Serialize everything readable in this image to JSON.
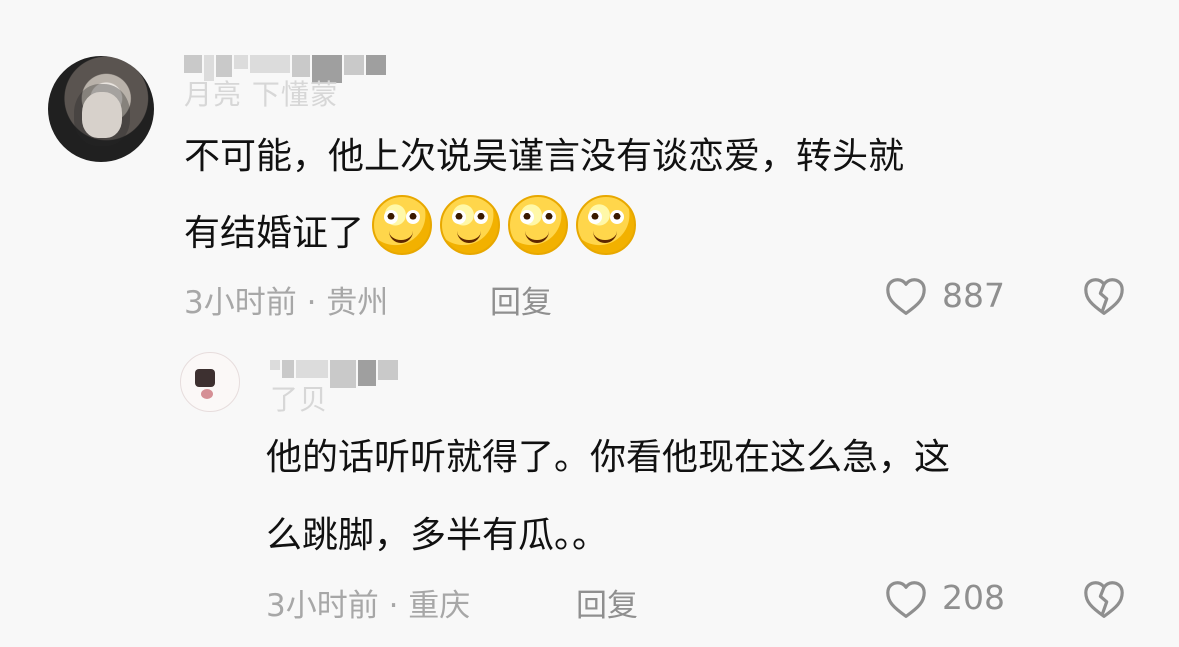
{
  "comments": [
    {
      "username": "月亮  下懂蒙",
      "text_line1": "不可能，他上次说吴谨言没有谈恋爱，转头就",
      "text_line2": "有结婚证了",
      "meta": "3小时前 · 贵州",
      "reply_label": "回复",
      "likes": "887"
    },
    {
      "username": "了贝",
      "text_line1": "他的话听听就得了。你看他现在这么急，这",
      "text_line2": "么跳脚，多半有瓜。。",
      "meta": "3小时前 · 重庆",
      "reply_label": "回复",
      "likes": "208"
    }
  ],
  "icons": {
    "like": "heart-outline-icon",
    "dislike": "broken-heart-icon",
    "emoji": "grinning-face-icon"
  },
  "colors": {
    "background": "#f8f8f8",
    "text": "#111111",
    "meta": "#a7a7a7",
    "action": "#8f8f8f",
    "emoji": "#ffd64b"
  }
}
